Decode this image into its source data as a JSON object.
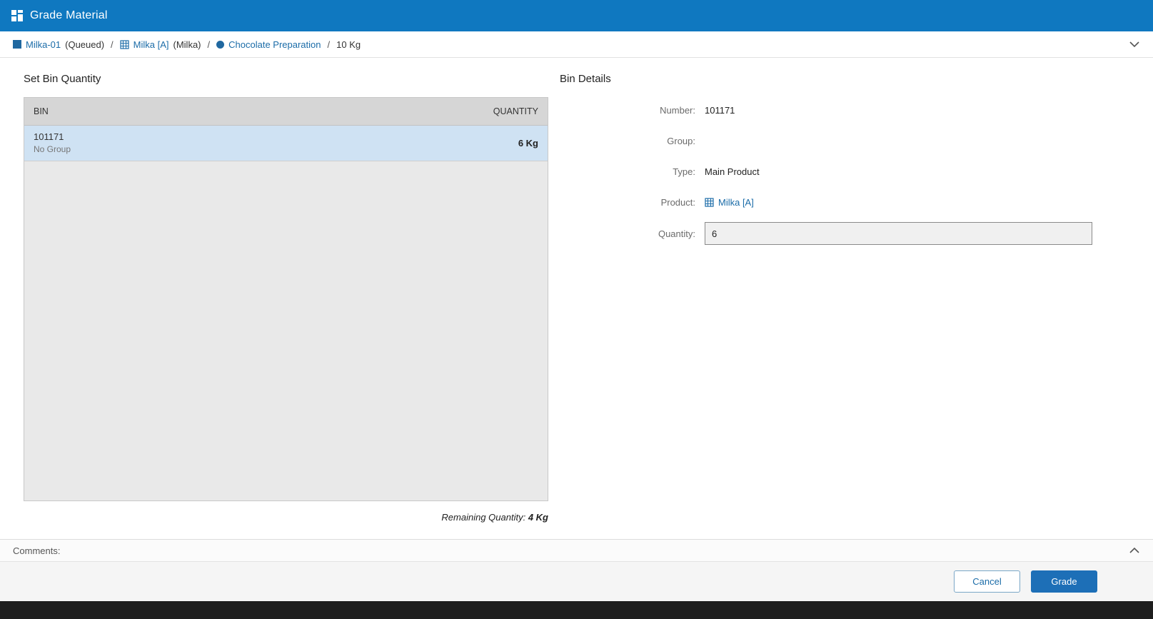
{
  "header": {
    "title": "Grade Material"
  },
  "breadcrumb": {
    "separator": "/",
    "items": [
      {
        "icon": "container-icon",
        "label": "Milka-01",
        "suffix": "(Queued)"
      },
      {
        "icon": "product-grid-icon",
        "label": "Milka [A]",
        "suffix": "(Milka)"
      },
      {
        "icon": "operation-icon",
        "label": "Chocolate Preparation",
        "suffix": ""
      },
      {
        "icon": "",
        "label": "10 Kg",
        "suffix": ""
      }
    ]
  },
  "bin_list": {
    "title": "Set Bin Quantity",
    "columns": {
      "bin": "BIN",
      "quantity": "QUANTITY"
    },
    "rows": [
      {
        "number": "101171",
        "group": "No Group",
        "quantity": "6 Kg",
        "selected": true
      }
    ],
    "remaining_label": "Remaining Quantity:",
    "remaining_value": "4 Kg"
  },
  "bin_details": {
    "title": "Bin Details",
    "number": {
      "label": "Number:",
      "value": "101171"
    },
    "group": {
      "label": "Group:",
      "value": ""
    },
    "type": {
      "label": "Type:",
      "value": "Main Product"
    },
    "product": {
      "label": "Product:",
      "value": "Milka [A]"
    },
    "quantity": {
      "label": "Quantity:",
      "value": "6"
    }
  },
  "comments": {
    "label": "Comments:"
  },
  "footer": {
    "cancel_label": "Cancel",
    "grade_label": "Grade"
  },
  "colors": {
    "topbar_blue": "#0f78c0",
    "link_blue": "#1b6ca8",
    "selected_row_blue": "#cfe2f3",
    "table_header_gray": "#d6d6d6",
    "list_body_gray": "#e9e9e9",
    "grade_button_blue": "#1d6fb7"
  }
}
